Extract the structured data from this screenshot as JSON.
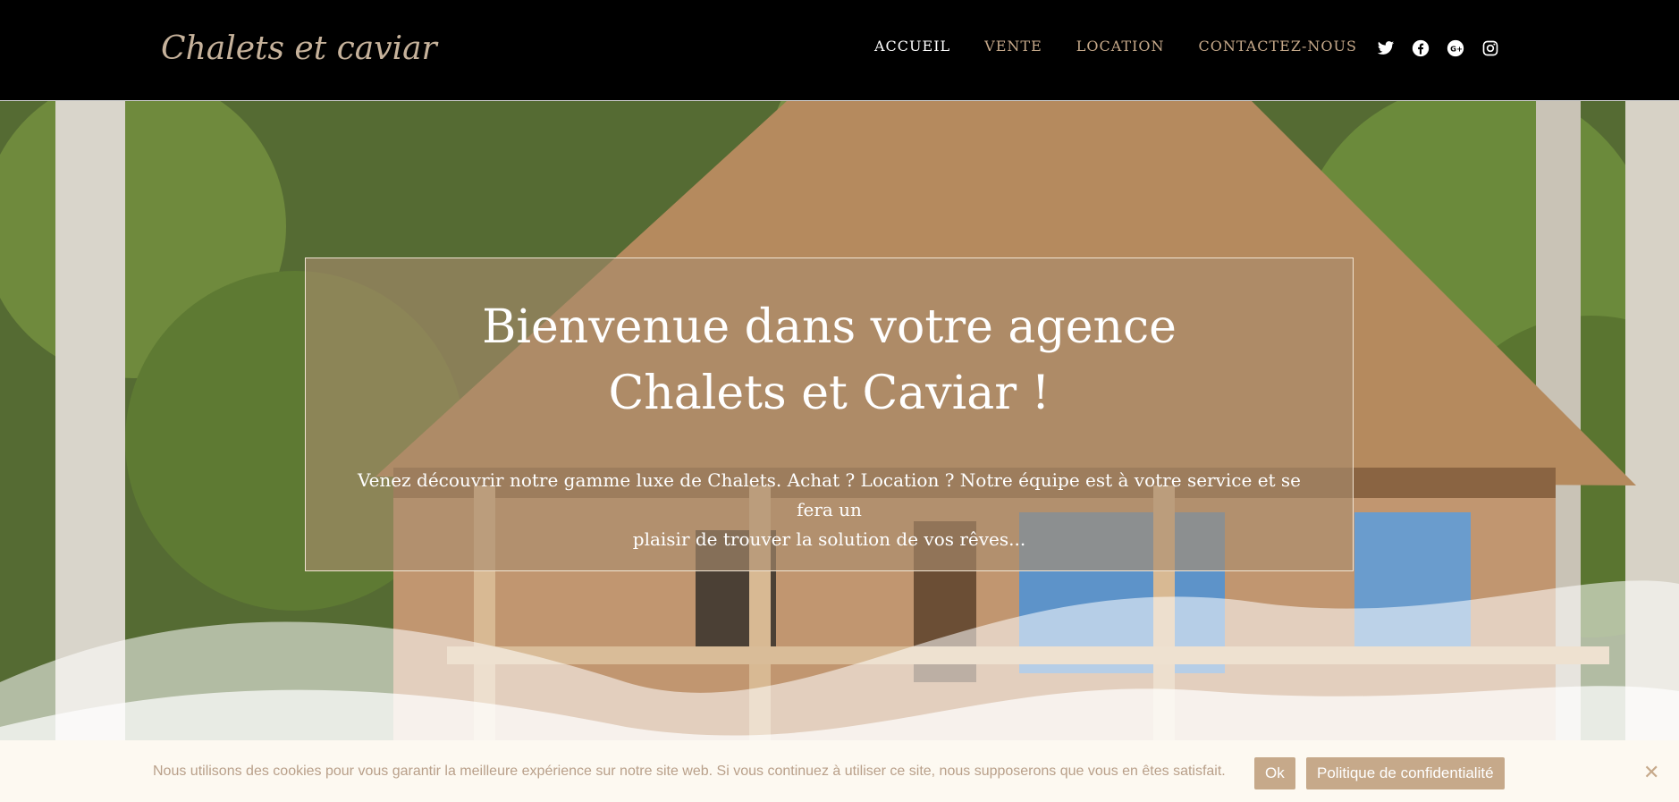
{
  "header": {
    "logo_text": "Chalets et caviar",
    "nav": [
      {
        "label": "ACCUEIL",
        "active": true
      },
      {
        "label": "VENTE",
        "active": false
      },
      {
        "label": "LOCATION",
        "active": false
      },
      {
        "label": "CONTACTEZ-NOUS",
        "active": false
      }
    ],
    "social_icons": [
      "twitter-icon",
      "facebook-icon",
      "google-plus-icon",
      "instagram-icon"
    ]
  },
  "hero": {
    "title_line1": "Bienvenue dans votre agence",
    "title_line2": "Chalets et Caviar !",
    "text_line1": "Venez découvrir notre gamme luxe de Chalets. Achat ? Location ? Notre équipe est à votre service et se fera un",
    "text_line2": "plaisir de trouver la solution de vos rêves..."
  },
  "cookie": {
    "text": "Nous utilisons des cookies pour vous garantir la meilleure expérience sur notre site web. Si vous continuez à utiliser ce site, nous supposerons que vous en êtes satisfait.",
    "ok_label": "Ok",
    "policy_label": "Politique de confidentialité",
    "close_symbol": "✕"
  },
  "colors": {
    "accent": "#c6a98a",
    "header_bg": "#000000",
    "cookie_bg": "#fdf9f1"
  }
}
